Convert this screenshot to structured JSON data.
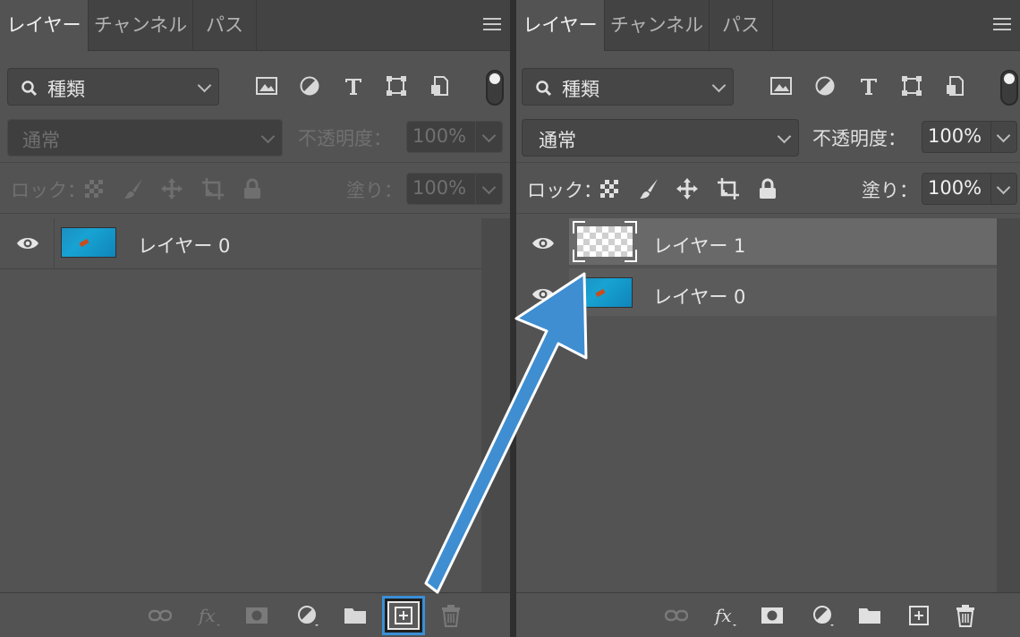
{
  "tabs": [
    "レイヤー",
    "チャンネル",
    "パス"
  ],
  "filter": {
    "icon": "search-icon",
    "label": "種類"
  },
  "filter_icons": [
    "image-filter-icon",
    "adjustment-filter-icon",
    "type-filter-icon",
    "shape-filter-icon",
    "smart-object-filter-icon",
    "filter-toggle-icon"
  ],
  "left_panel": {
    "blend_mode": "通常",
    "opacity_label": "不透明度：",
    "opacity_value": "100%",
    "lock_label": "ロック：",
    "fill_label": "塗り：",
    "fill_value": "100%",
    "layers": [
      {
        "name": "レイヤー 0",
        "visible": true,
        "thumbnail": "ocean-photo",
        "selected": false
      }
    ],
    "state": "disabled"
  },
  "right_panel": {
    "blend_mode": "通常",
    "opacity_label": "不透明度：",
    "opacity_value": "100%",
    "lock_label": "ロック：",
    "fill_label": "塗り：",
    "fill_value": "100%",
    "layers": [
      {
        "name": "レイヤー 1",
        "visible": true,
        "thumbnail": "transparent",
        "selected": true
      },
      {
        "name": "レイヤー 0",
        "visible": true,
        "thumbnail": "ocean-photo",
        "selected": false
      }
    ],
    "state": "enabled"
  },
  "bottom_icons": [
    "link-layers-icon",
    "fx-icon",
    "add-mask-icon",
    "adjustment-layer-icon",
    "new-group-icon",
    "new-layer-icon",
    "delete-layer-icon"
  ],
  "colors": {
    "panel": "#535353",
    "tabbar": "#434343",
    "selected_row": "#696969",
    "arrow": "#3f8ed1",
    "highlight_box": "#3a8fd6"
  }
}
